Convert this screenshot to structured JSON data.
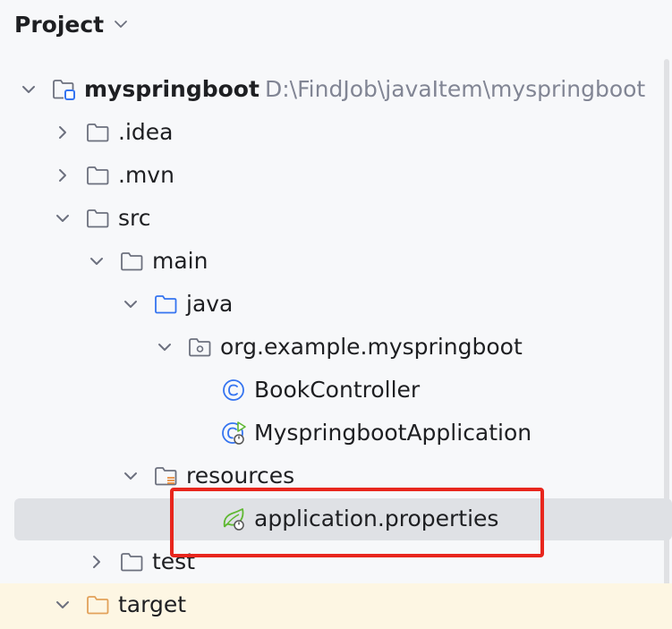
{
  "panel": {
    "title": "Project"
  },
  "tree": [
    {
      "name": "myspringboot",
      "path": "D:\\FindJob\\javaItem\\myspringboot",
      "icon": "module-icon",
      "arrow": "down"
    },
    {
      "name": ".idea",
      "icon": "folder-icon",
      "arrow": "right"
    },
    {
      "name": ".mvn",
      "icon": "folder-icon",
      "arrow": "right"
    },
    {
      "name": "src",
      "icon": "folder-icon",
      "arrow": "down"
    },
    {
      "name": "main",
      "icon": "folder-icon",
      "arrow": "down"
    },
    {
      "name": "java",
      "icon": "source-folder-icon",
      "arrow": "down"
    },
    {
      "name": "org.example.myspringboot",
      "icon": "package-icon",
      "arrow": "down"
    },
    {
      "name": "BookController",
      "icon": "class-icon",
      "arrow": "none"
    },
    {
      "name": "MyspringbootApplication",
      "icon": "spring-boot-app-icon",
      "arrow": "none"
    },
    {
      "name": "resources",
      "icon": "resources-folder-icon",
      "arrow": "down"
    },
    {
      "name": "application.properties",
      "icon": "spring-properties-icon",
      "arrow": "none",
      "selected": true
    },
    {
      "name": "test",
      "icon": "folder-icon",
      "arrow": "right"
    },
    {
      "name": "target",
      "icon": "excluded-folder-icon",
      "arrow": "down"
    }
  ],
  "colors": {
    "folder": "#6c707e",
    "source_folder": "#3574f0",
    "excluded_folder": "#e2a15a",
    "spring": "#5fb832",
    "highlight": "#e8261d"
  }
}
